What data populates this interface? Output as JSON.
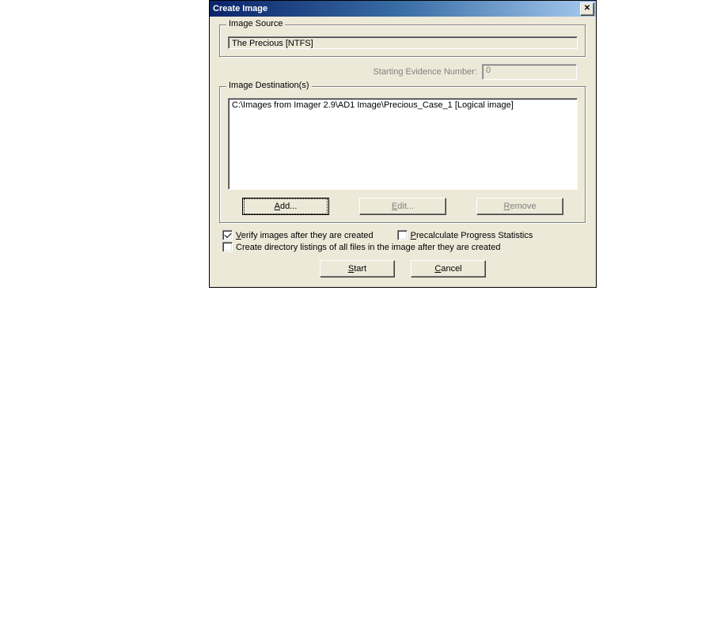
{
  "title": "Create Image",
  "groups": {
    "source_legend": "Image Source",
    "dest_legend": "Image Destination(s)"
  },
  "source_value": "The Precious [NTFS]",
  "evidence": {
    "label": "Starting Evidence Number:",
    "value": "0"
  },
  "destinations": [
    "C:\\Images from Imager 2.9\\AD1 Image\\Precious_Case_1 [Logical image]"
  ],
  "buttons": {
    "add": "Add...",
    "edit": "Edit...",
    "remove": "Remove",
    "start": "Start",
    "cancel": "Cancel"
  },
  "checkboxes": {
    "verify": {
      "label": "Verify images after they are created",
      "checked": true
    },
    "precalc": {
      "label": "Precalculate Progress Statistics",
      "checked": false
    },
    "listing": {
      "label": "Create directory listings of all files in the image after they are created",
      "checked": false
    }
  }
}
